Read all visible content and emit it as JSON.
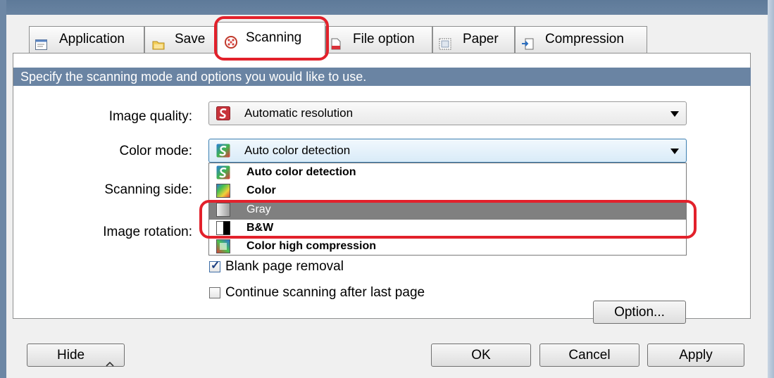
{
  "tabs": [
    {
      "label": "Application",
      "icon": "application-icon"
    },
    {
      "label": "Save",
      "icon": "folder-icon"
    },
    {
      "label": "Scanning",
      "icon": "scanning-icon",
      "selected": true
    },
    {
      "label": "File option",
      "icon": "file-icon"
    },
    {
      "label": "Paper",
      "icon": "paper-icon"
    },
    {
      "label": "Compression",
      "icon": "compression-icon"
    }
  ],
  "hint": "Specify the scanning mode and options you would like to use.",
  "fields": {
    "image_quality": {
      "label": "Image quality:",
      "value": "Automatic resolution",
      "icon": "scansnap-icon"
    },
    "color_mode": {
      "label": "Color mode:",
      "value": "Auto color detection",
      "icon": "auto-color-icon"
    },
    "scanning_side": {
      "label": "Scanning side:"
    },
    "image_rotation": {
      "label": "Image rotation:"
    }
  },
  "color_mode_options": [
    {
      "label": "Auto color detection",
      "icon": "auto-color-icon"
    },
    {
      "label": "Color",
      "icon": "color-icon"
    },
    {
      "label": "Gray",
      "icon": "gray-icon",
      "highlighted": true
    },
    {
      "label": "B&W",
      "icon": "bw-icon"
    },
    {
      "label": "Color high compression",
      "icon": "color-high-compression-icon"
    }
  ],
  "checkboxes": {
    "blank_page_removal": {
      "label": "Blank page removal",
      "checked": true
    },
    "continue_scanning": {
      "label": "Continue scanning after last page",
      "checked": false
    }
  },
  "buttons": {
    "option": "Option...",
    "hide": "Hide",
    "ok": "OK",
    "cancel": "Cancel",
    "apply": "Apply"
  },
  "colors": {
    "hint_bar": "#6a84a3",
    "highlight_ring": "#e2212b",
    "selected_option": "#808080"
  }
}
